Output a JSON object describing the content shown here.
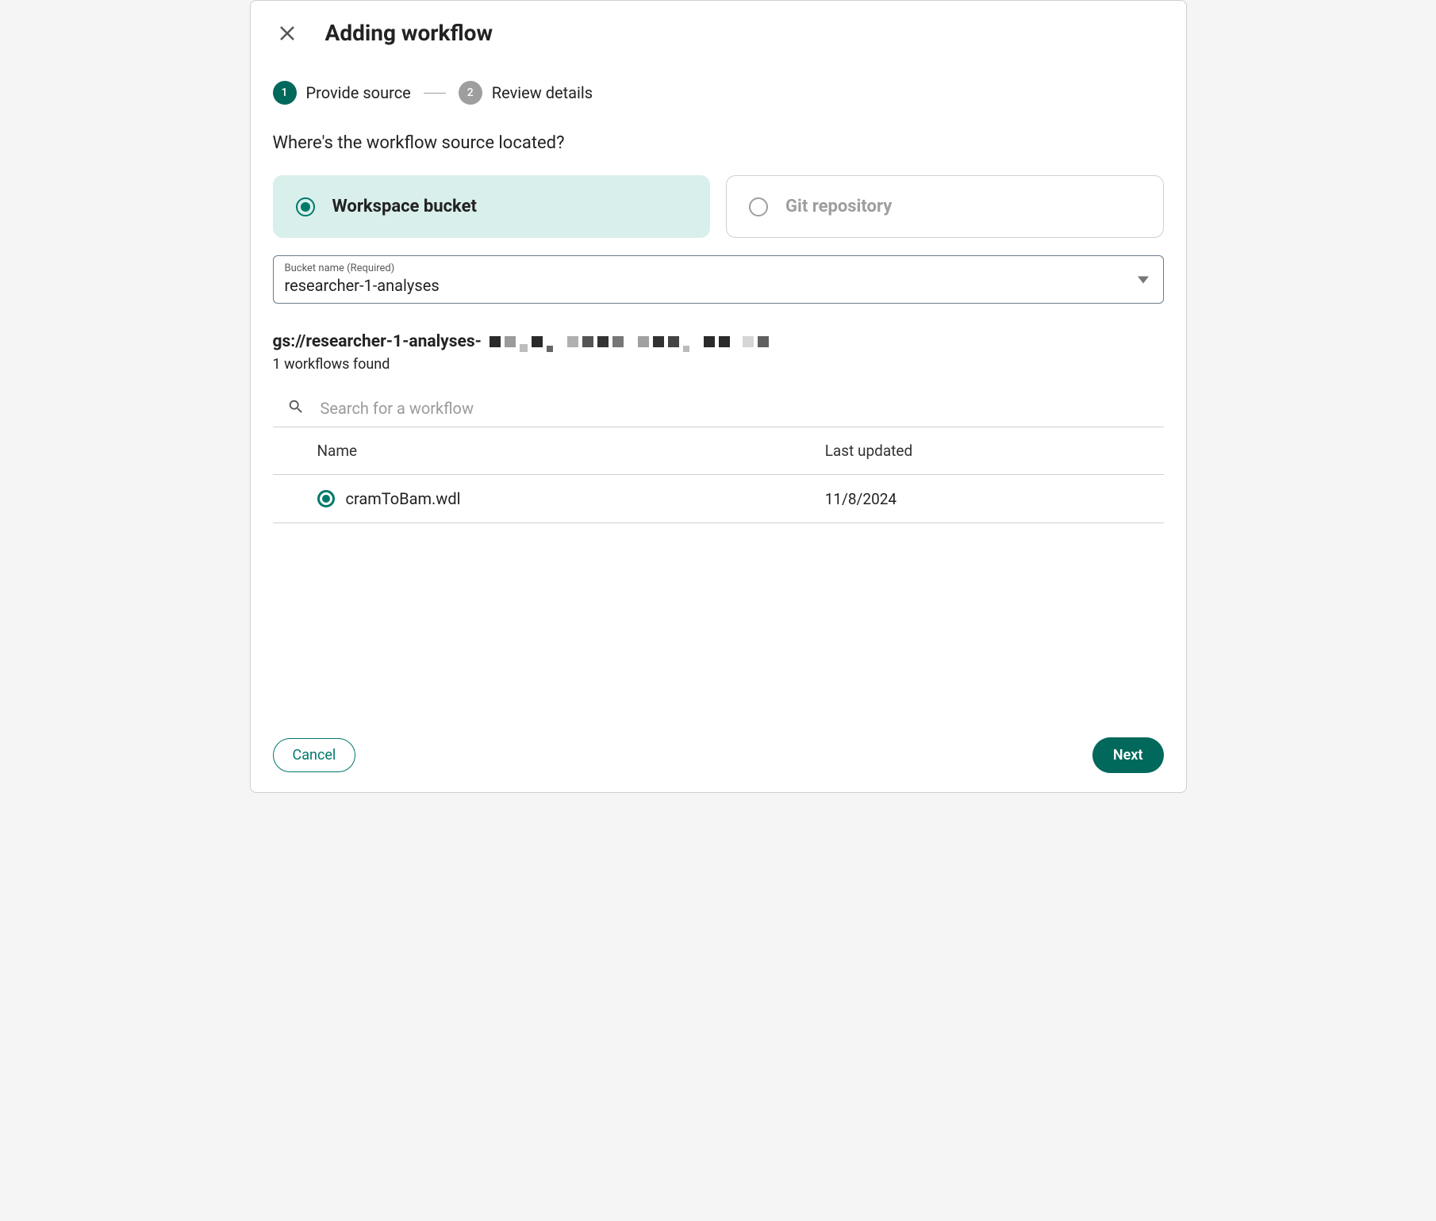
{
  "header": {
    "title": "Adding workflow"
  },
  "stepper": {
    "steps": [
      {
        "num": "1",
        "label": "Provide source",
        "active": true
      },
      {
        "num": "2",
        "label": "Review details",
        "active": false
      }
    ]
  },
  "question": "Where's the workflow source located?",
  "sources": {
    "workspace_bucket": "Workspace bucket",
    "git_repository": "Git repository"
  },
  "bucket_select": {
    "label": "Bucket name (Required)",
    "value": "researcher-1-analyses"
  },
  "gs_path_prefix": "gs://researcher-1-analyses-",
  "workflows_found": "1 workflows found",
  "search": {
    "placeholder": "Search for a workflow"
  },
  "table": {
    "columns": {
      "name": "Name",
      "last_updated": "Last updated"
    },
    "rows": [
      {
        "name": "cramToBam.wdl",
        "last_updated": "11/8/2024",
        "selected": true
      }
    ]
  },
  "footer": {
    "cancel": "Cancel",
    "next": "Next"
  }
}
